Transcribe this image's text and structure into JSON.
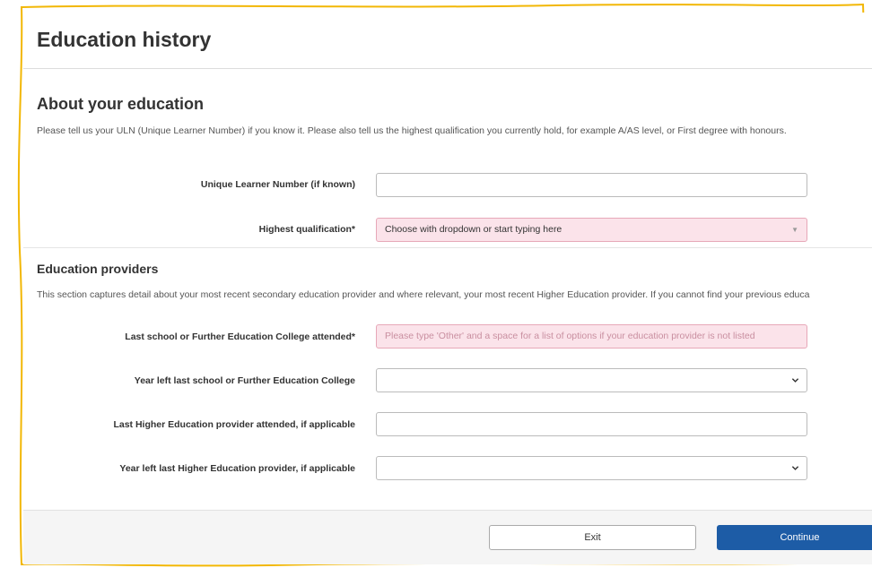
{
  "page": {
    "title": "Education history"
  },
  "about": {
    "title": "About your education",
    "description": "Please tell us your ULN (Unique Learner Number) if you know it. Please also tell us the highest qualification you currently hold, for example A/AS level, or First degree with honours.",
    "uln_label": "Unique Learner Number (if known)",
    "uln_value": "",
    "qualification_label": "Highest qualification*",
    "qualification_placeholder": "Choose with dropdown or start typing here"
  },
  "providers": {
    "title": "Education providers",
    "description": "This section captures detail about your most recent secondary education provider and where relevant, your most recent Higher Education provider. If you cannot find your previous educa",
    "school_label": "Last school or Further Education College attended*",
    "school_placeholder": "Please type 'Other' and a space for a list of options if your education provider is not listed",
    "year_school_label": "Year left last school or Further Education College",
    "year_school_value": "",
    "he_label": "Last Higher Education provider attended, if applicable",
    "he_value": "",
    "year_he_label": "Year left last Higher Education provider, if applicable",
    "year_he_value": ""
  },
  "footer": {
    "exit_label": "Exit",
    "continue_label": "Continue"
  },
  "colors": {
    "accent": "#1d5ca6",
    "required_bg": "#fbe3ea",
    "frame": "#f2b705"
  }
}
